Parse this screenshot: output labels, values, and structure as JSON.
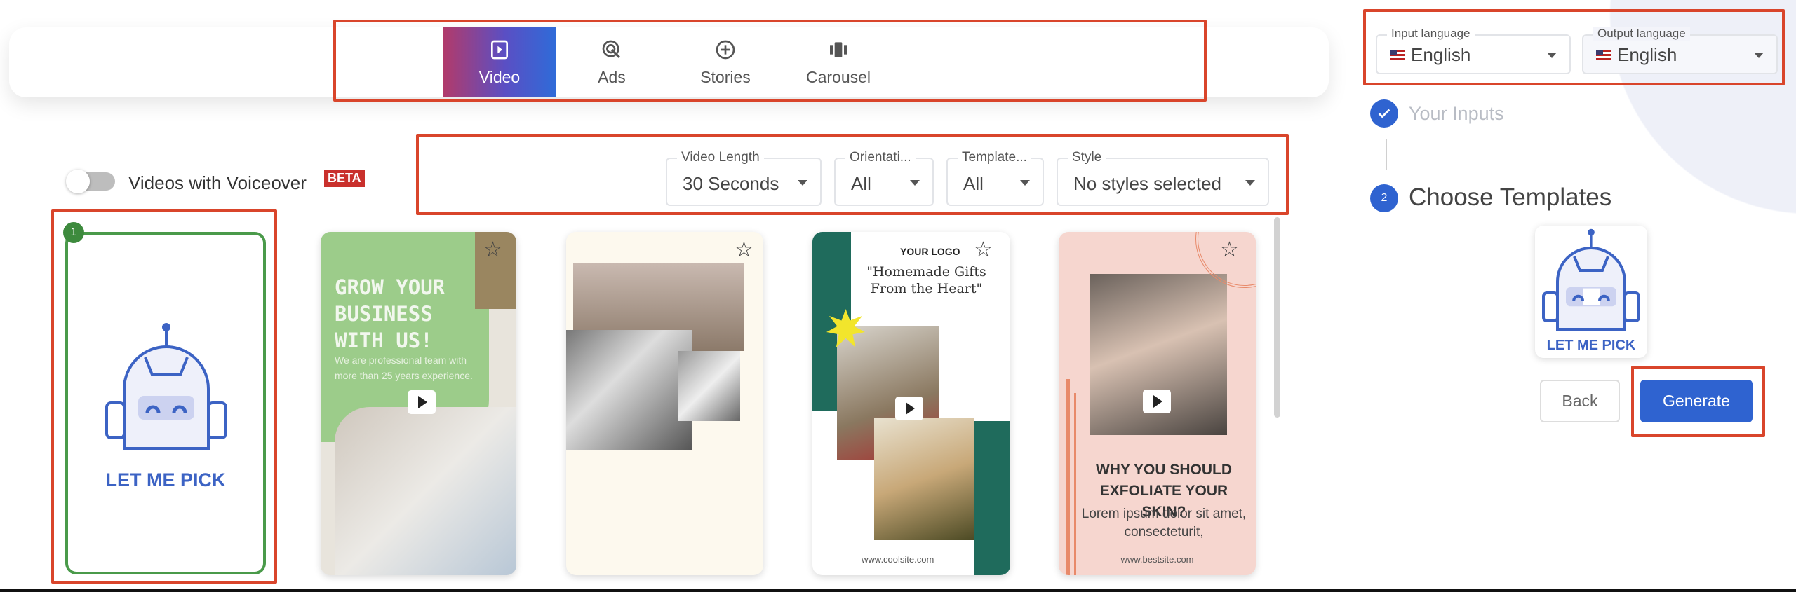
{
  "colors": {
    "accent": "#2f63d0",
    "highlight": "#d9452b",
    "selected": "#4a9a4a",
    "beta": "#c9302c"
  },
  "tabs": [
    {
      "label": "Video",
      "icon": "play-square-icon",
      "active": true
    },
    {
      "label": "Ads",
      "icon": "target-click-icon",
      "active": false
    },
    {
      "label": "Stories",
      "icon": "plus-circle-icon",
      "active": false
    },
    {
      "label": "Carousel",
      "icon": "carousel-icon",
      "active": false
    }
  ],
  "voiceover": {
    "label": "Videos with Voiceover",
    "badge": "BETA",
    "enabled": false
  },
  "filters": [
    {
      "label": "Video Length",
      "value": "30 Seconds"
    },
    {
      "label": "Orientati...",
      "value": "All"
    },
    {
      "label": "Template...",
      "value": "All"
    },
    {
      "label": "Style",
      "value": "No styles selected"
    }
  ],
  "languages": {
    "input": {
      "label": "Input language",
      "value": "English",
      "flag": "us-flag-icon"
    },
    "output": {
      "label": "Output language",
      "value": "English",
      "flag": "us-flag-icon"
    }
  },
  "steps": [
    {
      "label": "Your Inputs",
      "state": "done"
    },
    {
      "number": "2",
      "label": "Choose Templates",
      "state": "active"
    }
  ],
  "templates": [
    {
      "badge": "1",
      "label": "LET ME PICK",
      "selected": true
    },
    {
      "title": "GROW YOUR BUSINESS WITH US!",
      "body": "We are professional team with more than 25 years experience."
    },
    {},
    {
      "logo": "YOUR LOGO",
      "title": "\"Homemade Gifts From the Heart\"",
      "footer": "www.coolsite.com"
    },
    {
      "title": "WHY YOU SHOULD EXFOLIATE YOUR SKIN?",
      "body": "Lorem ipsum dolor sit amet, consecteturit,",
      "footer": "www.bestsite.com"
    }
  ],
  "selected_preview": {
    "label": "LET ME PICK"
  },
  "buttons": {
    "back": "Back",
    "generate": "Generate"
  }
}
